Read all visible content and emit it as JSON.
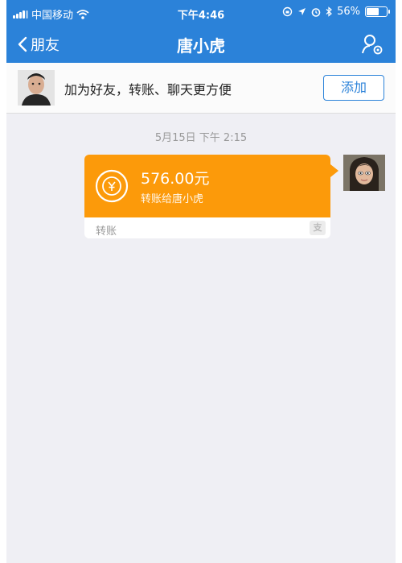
{
  "status_bar": {
    "carrier": "中国移动",
    "time": "下午4:46",
    "battery_percent": "56%",
    "battery_level": 0.56,
    "icons": [
      "signal-icon",
      "wifi-icon",
      "lock-rotation-icon",
      "location-icon",
      "alarm-icon",
      "bluetooth-icon",
      "battery-icon"
    ]
  },
  "nav": {
    "back_label": "朋友",
    "title": "唐小虎",
    "right_icon": "profile-settings-icon"
  },
  "add_friend": {
    "prompt": "加为好友，转账、聊天更方便",
    "button": "添加"
  },
  "chat": {
    "timestamp": "5月15日 下午 2:15",
    "transfer": {
      "amount": "576.00元",
      "description": "转账给唐小虎",
      "footer": "转账",
      "footer_icon_text": "支"
    }
  },
  "colors": {
    "accent": "#2b82d9",
    "transfer_orange": "#fc9a0a",
    "background": "#efeff4"
  }
}
